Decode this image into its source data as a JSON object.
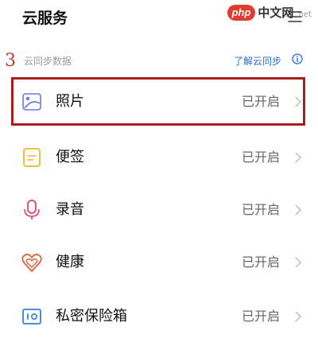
{
  "header": {
    "title": "云服务"
  },
  "watermark": {
    "brand": "php",
    "site": "中文网",
    "domain": ".net"
  },
  "annotation": {
    "step_number": "3"
  },
  "section": {
    "label": "云同步数据",
    "learn_link": "了解云同步"
  },
  "items": [
    {
      "label": "照片",
      "status": "已开启",
      "icon": "photos-icon",
      "color": "#6b7bd6"
    },
    {
      "label": "便签",
      "status": "已开启",
      "icon": "notes-icon",
      "color": "#f0b72a"
    },
    {
      "label": "录音",
      "status": "已开启",
      "icon": "microphone-icon",
      "color": "#e0436a"
    },
    {
      "label": "健康",
      "status": "已开启",
      "icon": "health-icon",
      "color": "#e0603a"
    },
    {
      "label": "私密保险箱",
      "status": "已开启",
      "icon": "safe-icon",
      "color": "#3a7fd6"
    }
  ],
  "colors": {
    "highlight_border": "#a61e1e",
    "link": "#2a6fd6"
  }
}
